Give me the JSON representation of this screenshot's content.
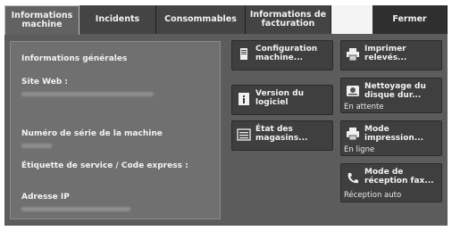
{
  "tabs": [
    {
      "label": "Informations machine"
    },
    {
      "label": "Incidents"
    },
    {
      "label": "Consommables"
    },
    {
      "label": "Informations de facturation"
    },
    {
      "label": ""
    },
    {
      "label": "Fermer"
    }
  ],
  "panel": {
    "title": "Informations générales",
    "site_web": "Site Web :",
    "serial": "Numéro de série de la machine",
    "service_tag": "Étiquette de service / Code express :",
    "ip": "Adresse IP"
  },
  "buttons": {
    "config": {
      "label": "Configuration machine..."
    },
    "version": {
      "label": "Version du logiciel"
    },
    "magasins": {
      "label": "État des magasins..."
    },
    "print_reports": {
      "label": "Imprimer relevés..."
    },
    "cleaning": {
      "label": "Nettoyage du disque dur...",
      "status": "En attente"
    },
    "print_mode": {
      "label": "Mode impression...",
      "status": "En ligne"
    },
    "fax_mode": {
      "label": "Mode de réception fax...",
      "status": "Réception auto"
    }
  },
  "colors": {
    "background": "#5c5c5c",
    "button": "#3f3f3f",
    "panel": "#707070"
  }
}
